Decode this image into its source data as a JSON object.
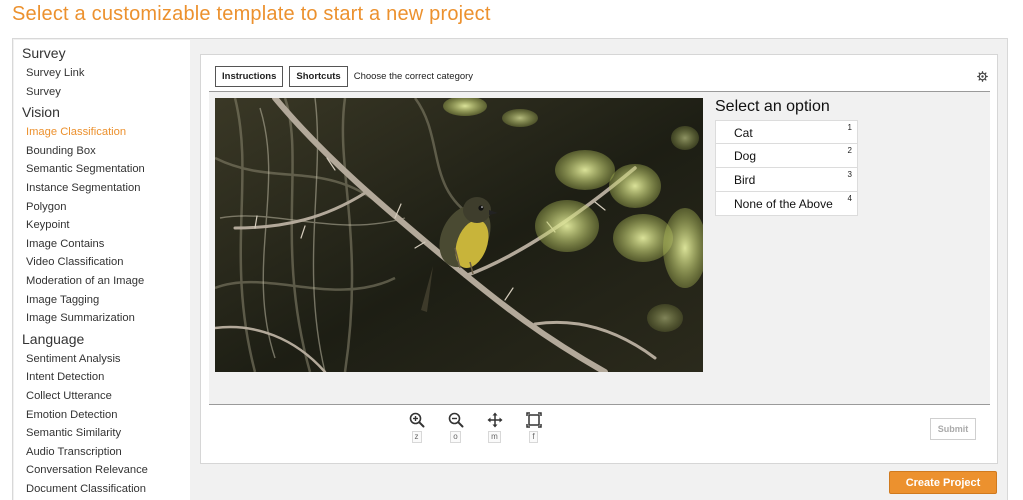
{
  "page": {
    "title": "Select a customizable template to start a new project"
  },
  "sidebar": {
    "categories": [
      {
        "heading": "Survey",
        "items": [
          "Survey Link",
          "Survey"
        ]
      },
      {
        "heading": "Vision",
        "items": [
          "Image Classification",
          "Bounding Box",
          "Semantic Segmentation",
          "Instance Segmentation",
          "Polygon",
          "Keypoint",
          "Image Contains",
          "Video Classification",
          "Moderation of an Image",
          "Image Tagging",
          "Image Summarization"
        ]
      },
      {
        "heading": "Language",
        "items": [
          "Sentiment Analysis",
          "Intent Detection",
          "Collect Utterance",
          "Emotion Detection",
          "Semantic Similarity",
          "Audio Transcription",
          "Conversation Relevance",
          "Document Classification"
        ]
      }
    ],
    "active_item": "Image Classification"
  },
  "task": {
    "instructions_label": "Instructions",
    "shortcuts_label": "Shortcuts",
    "prompt": "Choose the correct category",
    "settings_icon": "gear-icon",
    "options_title": "Select an option",
    "options": [
      {
        "label": "Cat",
        "key": "1"
      },
      {
        "label": "Dog",
        "key": "2"
      },
      {
        "label": "Bird",
        "key": "3"
      },
      {
        "label": "None of the Above",
        "key": "4"
      }
    ],
    "tools": [
      {
        "icon": "zoom-in-icon",
        "hint": "z"
      },
      {
        "icon": "zoom-out-icon",
        "hint": "o"
      },
      {
        "icon": "move-icon",
        "hint": "m"
      },
      {
        "icon": "fit-screen-icon",
        "hint": "f"
      }
    ],
    "submit_label": "Submit"
  },
  "footer": {
    "create_label": "Create Project"
  },
  "colors": {
    "accent": "#ec912e",
    "panel_bg": "#f1f1f1"
  }
}
